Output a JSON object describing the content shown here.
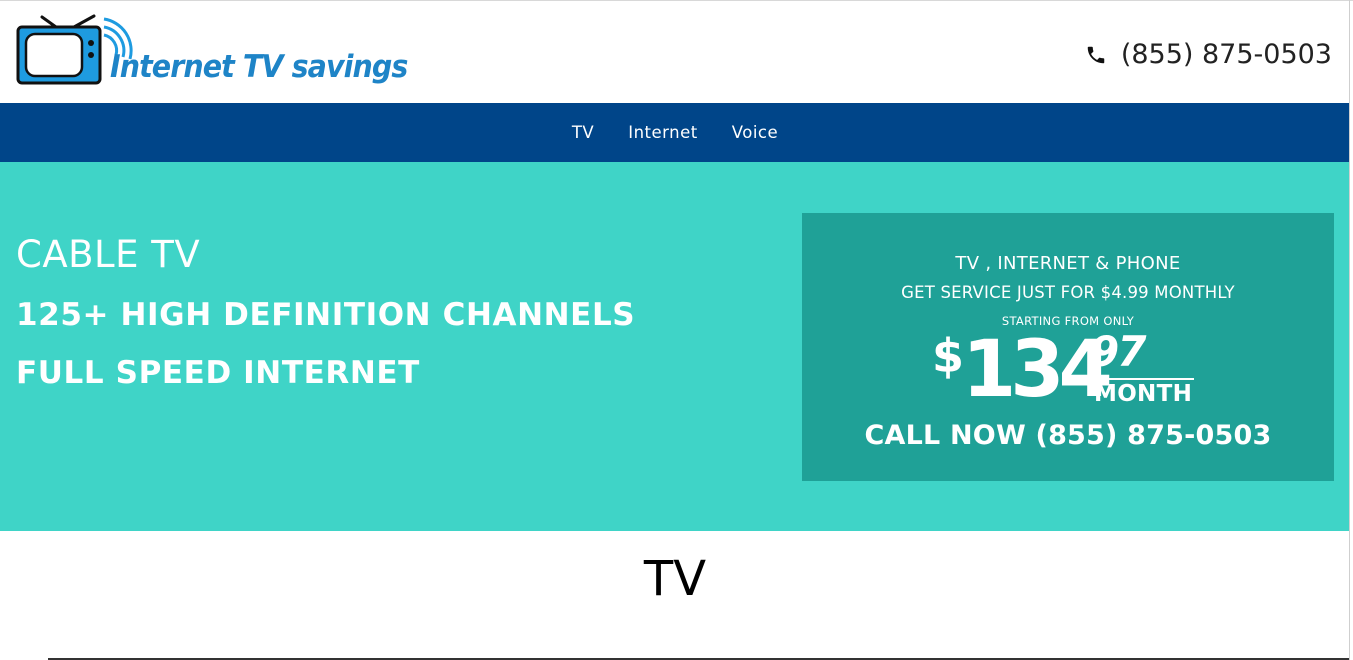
{
  "header": {
    "logo_text": "Internet TV savings",
    "phone": "(855) 875-0503",
    "icons": {
      "logo": "tv-logo-icon",
      "phone": "phone-icon"
    }
  },
  "nav": {
    "items": [
      {
        "label": "TV"
      },
      {
        "label": "Internet"
      },
      {
        "label": "Voice"
      }
    ]
  },
  "hero": {
    "line1": "CABLE TV",
    "line2": "125+ HIGH DEFINITION CHANNELS",
    "line3": "FULL SPEED INTERNET"
  },
  "offer": {
    "headline": "TV , INTERNET & PHONE",
    "subheadline": "GET SERVICE JUST FOR $4.99 MONTHLY",
    "starting_text": "STARTING FROM ONLY",
    "price_currency": "$",
    "price_main": "134",
    "price_cents": "97",
    "price_unit": "MONTH",
    "call_text": "CALL NOW (855) 875-0503"
  },
  "section": {
    "title": "TV"
  },
  "colors": {
    "nav_bg": "#004589",
    "hero_bg": "#3fd4c7",
    "offer_bg": "#1fa197",
    "logo_blue": "#1e84c7"
  }
}
